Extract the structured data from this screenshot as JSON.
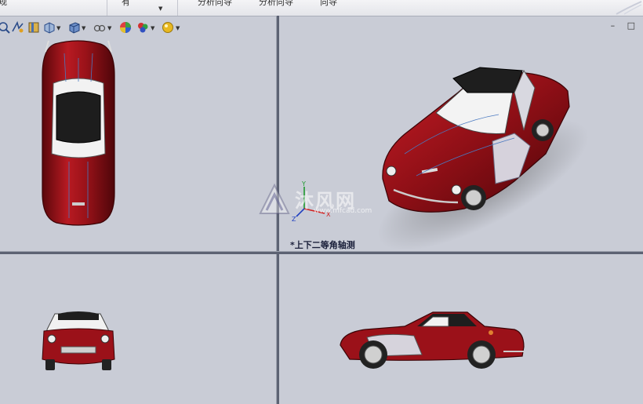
{
  "toolbar": {
    "items": [
      {
        "label": "规"
      },
      {
        "label": "有"
      },
      {
        "label": "分析向导"
      },
      {
        "label": "分析向导"
      },
      {
        "label": "向导"
      }
    ]
  },
  "viewport": {
    "active_view_label": "*上下二等角轴测",
    "window_controls": "– □"
  },
  "watermark": {
    "text": "沐风网",
    "url": "www.mfcad.com"
  },
  "axes": {
    "x": "X",
    "y": "Y",
    "z": "Z"
  },
  "colors": {
    "car_body": "#8e0f16",
    "background": "#c9ccd6",
    "splitter": "#5c6273"
  },
  "icons": [
    "zoom-to-fit-icon",
    "zoom-area-icon",
    "previous-view-icon",
    "section-view-icon",
    "view-orientation-icon",
    "display-style-icon",
    "hide-show-icon",
    "edit-appearance-icon",
    "apply-scene-icon"
  ]
}
